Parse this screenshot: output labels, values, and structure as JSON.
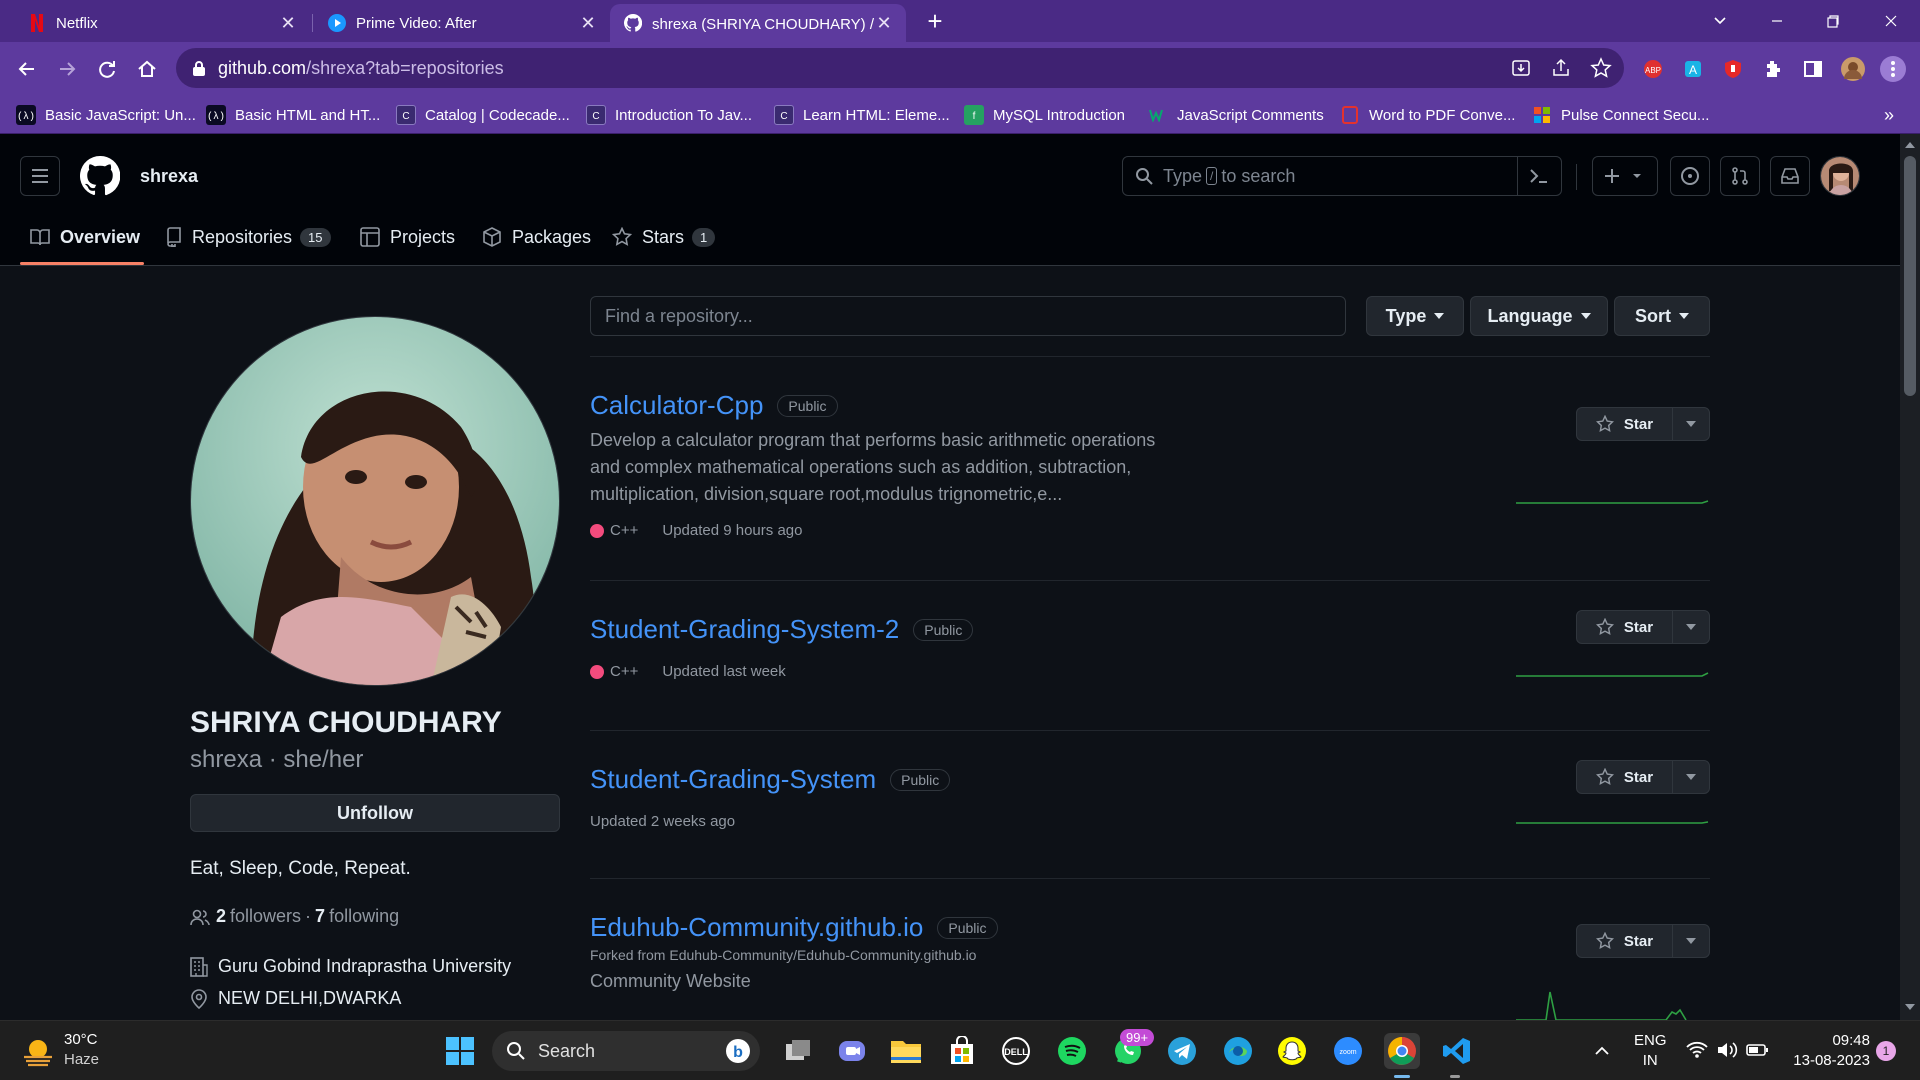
{
  "browser": {
    "tabs": [
      {
        "title": "Netflix",
        "active": false
      },
      {
        "title": "Prime Video: After",
        "active": false
      },
      {
        "title": "shrexa (SHRIYA CHOUDHARY) / Ⓡ",
        "active": true
      }
    ],
    "url_host": "github.com",
    "url_path": "/shrexa?tab=repositories",
    "bookmarks": [
      "Basic JavaScript: Un...",
      "Basic HTML and HT...",
      "Catalog | Codecade...",
      "Introduction To Jav...",
      "Learn HTML: Eleme...",
      "MySQL Introduction",
      "JavaScript Comments",
      "Word to PDF Conve...",
      "Pulse Connect Secu..."
    ],
    "overflow": "»"
  },
  "github": {
    "username": "shrexa",
    "search_placeholder_pre": "Type",
    "search_key": "/",
    "search_placeholder_post": "to search",
    "nav": {
      "overview": "Overview",
      "repositories": "Repositories",
      "repositories_count": "15",
      "projects": "Projects",
      "packages": "Packages",
      "stars": "Stars",
      "stars_count": "1"
    }
  },
  "profile": {
    "full_name": "SHRIYA CHOUDHARY",
    "handle_pronouns": "shrexa · she/her",
    "unfollow_label": "Unfollow",
    "bio": "Eat, Sleep, Code, Repeat.",
    "followers_count": "2",
    "followers_label": "followers",
    "sep": "·",
    "following_count": "7",
    "following_label": "following",
    "organization": "Guru Gobind Indraprastha University",
    "location": "NEW DELHI,DWARKA"
  },
  "filters": {
    "find_placeholder": "Find a repository...",
    "type": "Type",
    "language": "Language",
    "sort": "Sort"
  },
  "repos": [
    {
      "name": "Calculator-Cpp",
      "visibility": "Public",
      "description": "Develop a calculator program that performs basic arithmetic operations and complex mathematical operations such as addition, subtraction, multiplication, division,square root,modulus trignometric,e...",
      "language": "C++",
      "updated": "Updated 9 hours ago",
      "star_label": "Star"
    },
    {
      "name": "Student-Grading-System-2",
      "visibility": "Public",
      "language": "C++",
      "updated": "Updated last week",
      "star_label": "Star"
    },
    {
      "name": "Student-Grading-System",
      "visibility": "Public",
      "updated": "Updated 2 weeks ago",
      "star_label": "Star"
    },
    {
      "name": "Eduhub-Community.github.io",
      "visibility": "Public",
      "forked_from": "Forked from Eduhub-Community/Eduhub-Community.github.io",
      "description": "Community Website",
      "star_label": "Star"
    }
  ],
  "taskbar": {
    "weather_temp": "30°C",
    "weather_desc": "Haze",
    "search_label": "Search",
    "whatsapp_badge": "99+",
    "lang_top": "ENG",
    "lang_bottom": "IN",
    "time": "09:48",
    "date": "13-08-2023",
    "notif_count": "1"
  },
  "colors": {
    "accent_link": "#4493f8",
    "cpp": "#f34b7d",
    "chrome_purple": "#5d3a9e",
    "tab_active_underline": "#f78166"
  }
}
